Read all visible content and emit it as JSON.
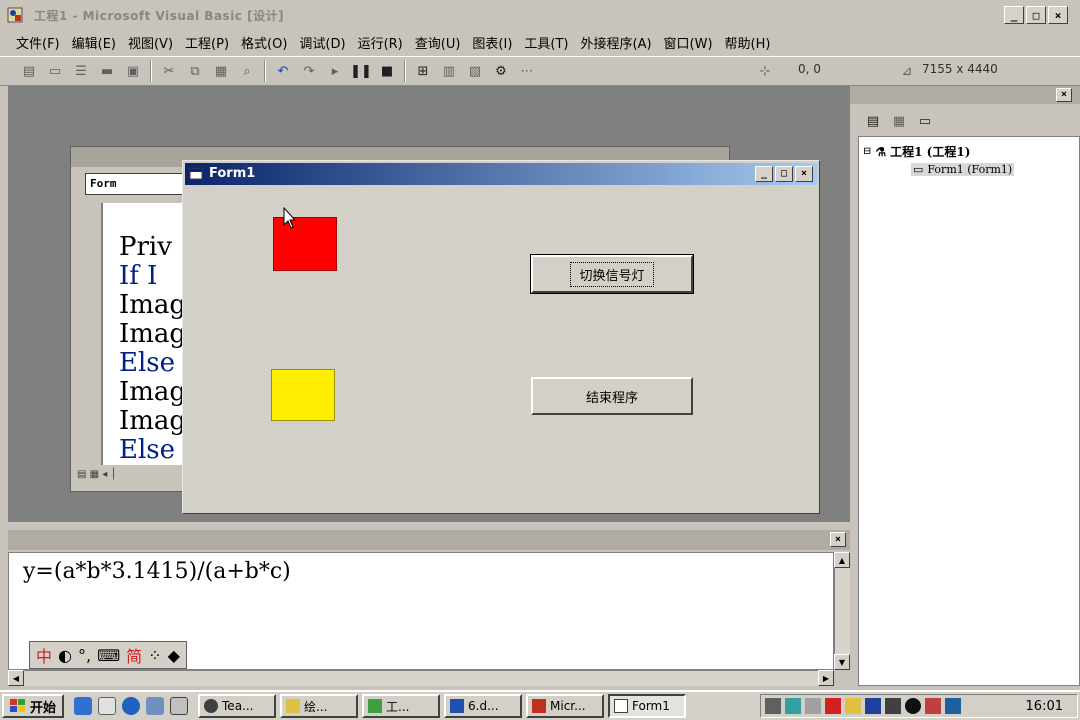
{
  "window": {
    "title": "工程1 - Microsoft Visual Basic [设计]",
    "min_label": "_",
    "max_label": "□",
    "close_label": "×"
  },
  "menu": [
    "文件(F)",
    "编辑(E)",
    "视图(V)",
    "工程(P)",
    "格式(O)",
    "调试(D)",
    "运行(R)",
    "查询(U)",
    "图表(I)",
    "工具(T)",
    "外接程序(A)",
    "窗口(W)",
    "帮助(H)"
  ],
  "toolbar": {
    "position": "0, 0",
    "size": "7155 x 4440"
  },
  "code_window": {
    "object_combo": "Form",
    "lines": [
      "Priv",
      "If I",
      "Imag",
      "Imag",
      "Else",
      "Imag",
      "Imag",
      "Else"
    ]
  },
  "form1": {
    "title": "Form1",
    "button_toggle": "切换信号灯",
    "button_exit": "结束程序",
    "red_color": "#ff0000",
    "yellow_color": "#ffee00"
  },
  "explorer": {
    "root": "工程1 (工程1)",
    "child": "Form1 (Form1)"
  },
  "immediate": {
    "code": "y=(a*b*3.1415)/(a+b*c)",
    "ime": {
      "lang": "中",
      "mode": "简"
    }
  },
  "taskbar": {
    "start": "开始",
    "buttons": [
      "Tea...",
      "绘...",
      "工...",
      "6.d...",
      "Micr...",
      "Form1"
    ],
    "clock": "16:01"
  }
}
